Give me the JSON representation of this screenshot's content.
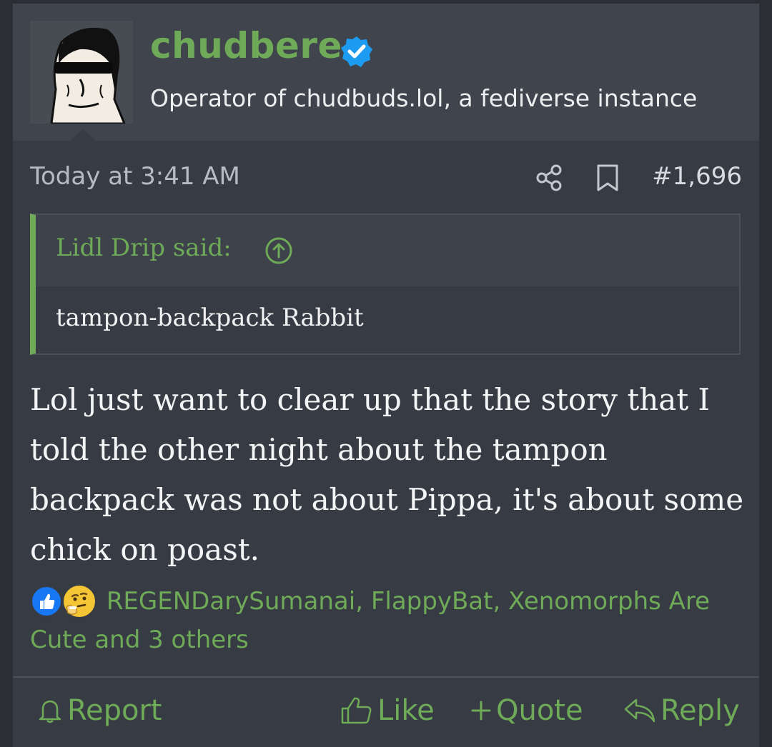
{
  "user": {
    "name": "chudbere",
    "title": "Operator of chudbuds.lol, a fediverse instance"
  },
  "post": {
    "date": "Today at 3:41 AM",
    "number": "#1,696",
    "quote": {
      "author": "Lidl Drip said:",
      "text": "tampon-backpack Rabbit"
    },
    "body": "Lol just want to clear up that the story that I told the other night about the tampon backpack was not about Pippa, it's about some chick on poast.",
    "reactions": {
      "text": "REGENDarySumanai, FlappyBat, Xenomorphs Are Cute and 3 others",
      "icons": [
        "like-react-icon",
        "thinking-react-icon"
      ]
    }
  },
  "actions": {
    "report": "Report",
    "like": "Like",
    "quote": "Quote",
    "reply": "Reply"
  },
  "colors": {
    "accent": "#6eaa57",
    "background": "#373b43",
    "header": "#40444c",
    "verified": "#1d9bf0"
  }
}
